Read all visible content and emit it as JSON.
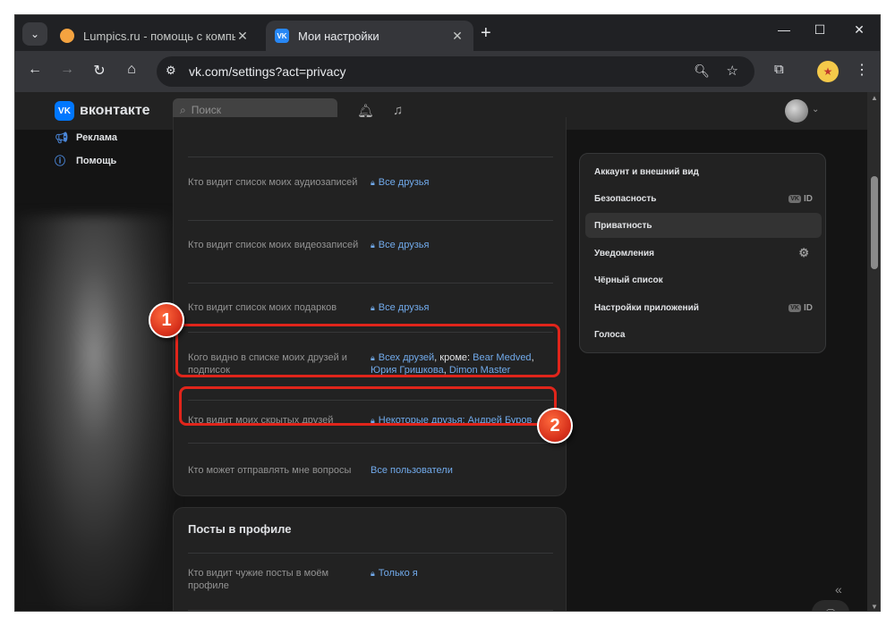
{
  "browser": {
    "tabs": [
      {
        "title": "Lumpics.ru - помощь с компьютером",
        "active": false
      },
      {
        "title": "Мои настройки",
        "active": true
      }
    ],
    "url": "vk.com/settings?act=privacy"
  },
  "vk": {
    "logo_text": "вконтакте",
    "search_placeholder": "Поиск",
    "left_nav": [
      {
        "label": "Реклама",
        "icon": "megaphone-icon"
      },
      {
        "label": "Помощь",
        "icon": "help-icon"
      }
    ],
    "privacy_rows": [
      {
        "label": "Кто видит список моих аудиозаписей",
        "value": "Все друзья"
      },
      {
        "label": "Кто видит список моих видеозаписей",
        "value": "Все друзья"
      },
      {
        "label": "Кто видит список моих подарков",
        "value": "Все друзья"
      },
      {
        "label": "Кого видно в списке моих друзей и подписок",
        "value_parts": {
          "all": "Всех друзей",
          "except": ", кроме: ",
          "p1": "Bear Medved",
          "sep1": ",",
          "p2": "Юрия Гришкова",
          "sep2": ", ",
          "p3": "Dimon Master"
        }
      },
      {
        "label": "Кто видит моих скрытых друзей",
        "value_parts": {
          "some": "Некоторые друзья",
          "sep": ": ",
          "p1": "Андрей Буров"
        }
      },
      {
        "label": "Кто может отправлять мне вопросы",
        "value": "Все пользователи"
      }
    ],
    "posts_section": {
      "title": "Посты в профиле",
      "rows": [
        {
          "label": "Кто видит чужие посты в моём профиле",
          "value": "Только я"
        }
      ]
    },
    "settings_menu": [
      {
        "label": "Аккаунт и внешний вид"
      },
      {
        "label": "Безопасность",
        "badge": "ID"
      },
      {
        "label": "Приватность",
        "active": true
      },
      {
        "label": "Уведомления"
      },
      {
        "label": "Чёрный список"
      },
      {
        "label": "Настройки приложений",
        "badge": "ID"
      },
      {
        "label": "Голоса"
      }
    ]
  },
  "annotations": [
    "1",
    "2"
  ],
  "colors": {
    "accent": "#71aaeb",
    "highlight": "#e0251b",
    "vk_blue": "#0077ff"
  }
}
